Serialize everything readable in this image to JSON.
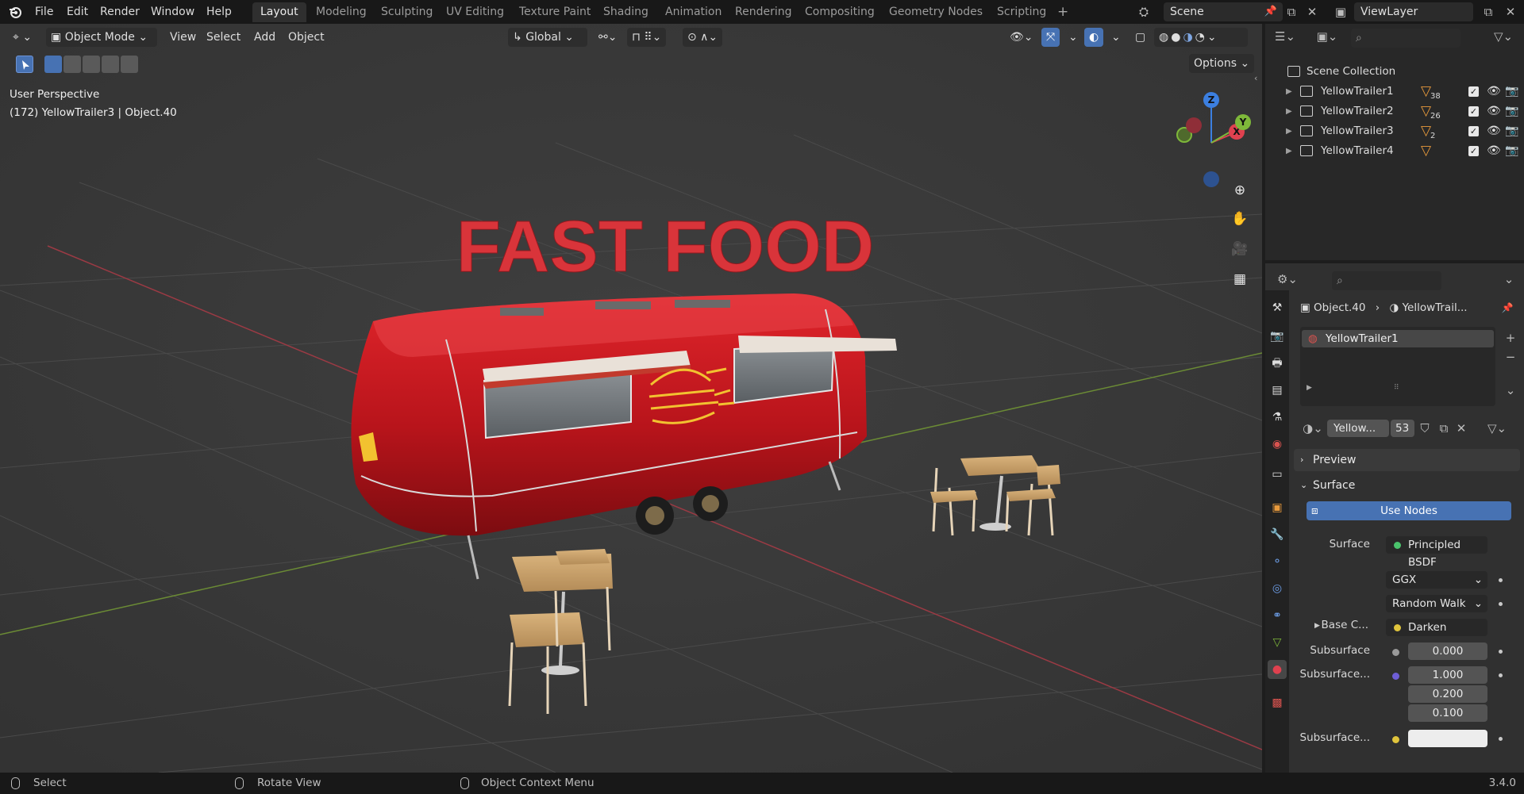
{
  "topbar": {
    "menu": [
      "File",
      "Edit",
      "Render",
      "Window",
      "Help"
    ],
    "workspaces": [
      "Layout",
      "Modeling",
      "Sculpting",
      "UV Editing",
      "Texture Paint",
      "Shading",
      "Animation",
      "Rendering",
      "Compositing",
      "Geometry Nodes",
      "Scripting"
    ],
    "active_workspace": "Layout",
    "add_workspace": "+",
    "scene": "Scene",
    "view_layer": "ViewLayer"
  },
  "viewport": {
    "mode": "Object Mode",
    "menus": [
      "View",
      "Select",
      "Add",
      "Object"
    ],
    "orientation": "Global",
    "options": "Options",
    "info_line1": "User Perspective",
    "info_line2": "(172) YellowTrailer3 | Object.40",
    "scene_sign": "FAST FOOD",
    "gizmo": {
      "x": "X",
      "y": "Y",
      "z": "Z"
    }
  },
  "outliner": {
    "root": "Scene Collection",
    "items": [
      {
        "name": "YellowTrailer1",
        "count": "38"
      },
      {
        "name": "YellowTrailer2",
        "count": "26"
      },
      {
        "name": "YellowTrailer3",
        "count": "2"
      },
      {
        "name": "YellowTrailer4",
        "count": ""
      }
    ]
  },
  "properties": {
    "breadcrumb_object": "Object.40",
    "breadcrumb_material": "YellowTrail...",
    "slot": "YellowTrailer1",
    "material_name": "Yellow...",
    "user_count": "53",
    "preview": "Preview",
    "surface_panel": "Surface",
    "use_nodes": "Use Nodes",
    "surface_label": "Surface",
    "surface_value": "Principled BSDF",
    "distribution": "GGX",
    "subsurface_method": "Random Walk",
    "base_color_label": "Base C...",
    "base_color_value": "Darken",
    "subsurface_label": "Subsurface",
    "subsurface_value": "0.000",
    "subsurface_radius_label": "Subsurface...",
    "subsurface_radius": [
      "1.000",
      "0.200",
      "0.100"
    ],
    "subsurface_color_label": "Subsurface..."
  },
  "statusbar": {
    "select": "Select",
    "rotate": "Rotate View",
    "context": "Object Context Menu",
    "version": "3.4.0"
  },
  "colors": {
    "accent_blue": "#4772b3",
    "trailer_red": "#c0161c",
    "axis_x": "#e0414f",
    "axis_y": "#7eb83a",
    "axis_z": "#3c7fe0"
  }
}
